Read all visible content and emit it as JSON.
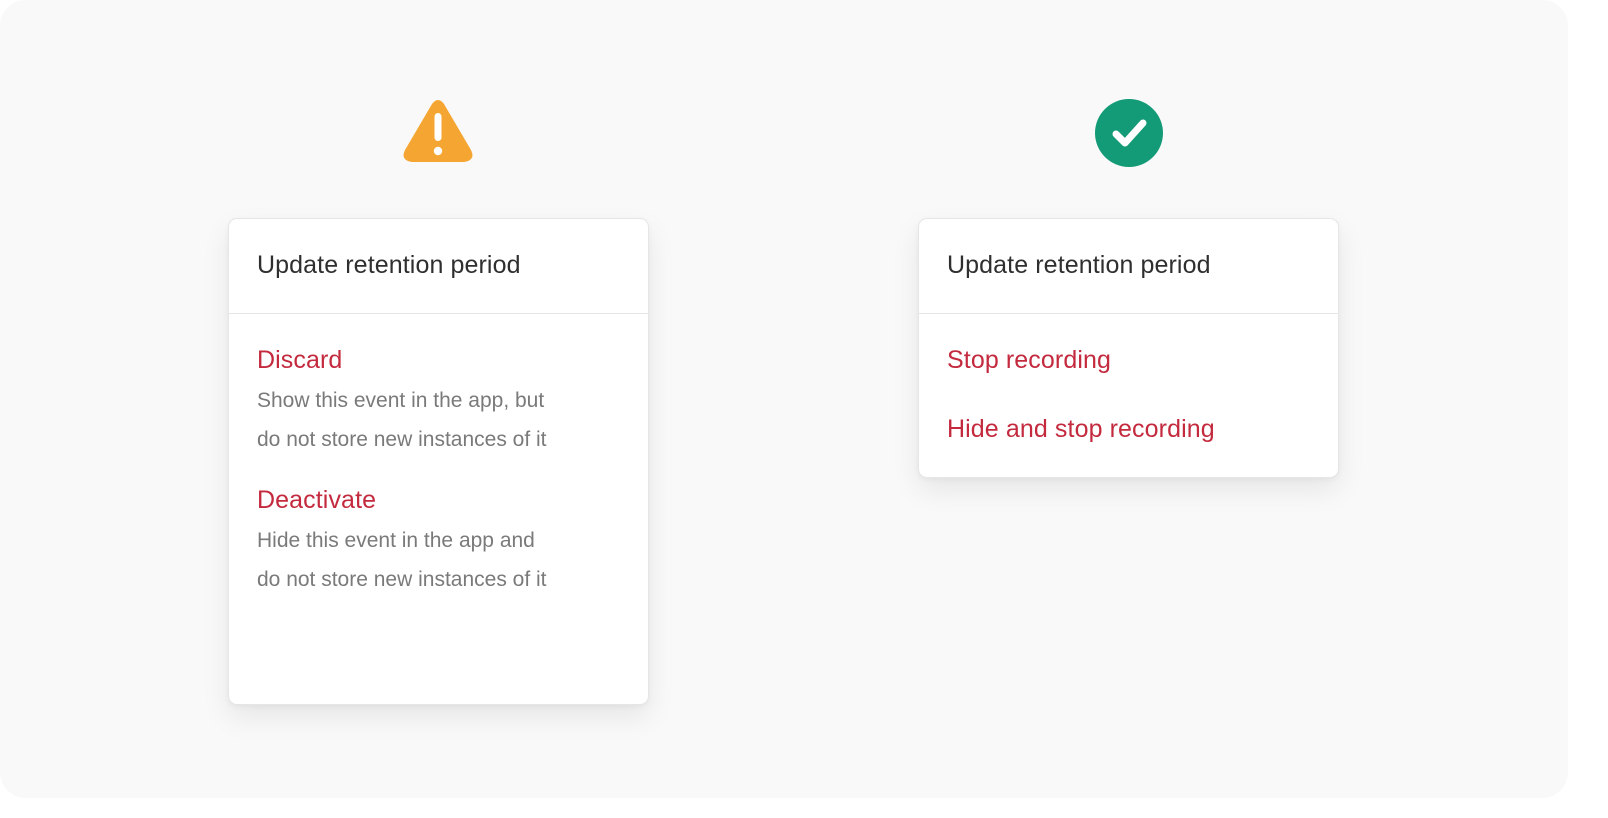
{
  "colors": {
    "background": "#f9f9f9",
    "warning": "#f5a632",
    "success": "#139a76",
    "destructive_text": "#c42a3e",
    "title_text": "#2f2f2f",
    "description_text": "#7a7a7a"
  },
  "left_example": {
    "status_icon": "warning-triangle-icon",
    "menu": {
      "title": "Update retention period",
      "options": [
        {
          "label": "Discard",
          "description": "Show this event in the app, but do not store new instances of it"
        },
        {
          "label": "Deactivate",
          "description": "Hide this event in the app and do not store new instances of it"
        }
      ]
    }
  },
  "right_example": {
    "status_icon": "check-circle-icon",
    "menu": {
      "title": "Update retention period",
      "options": [
        {
          "label": "Stop recording"
        },
        {
          "label": "Hide and stop recording"
        }
      ]
    }
  }
}
